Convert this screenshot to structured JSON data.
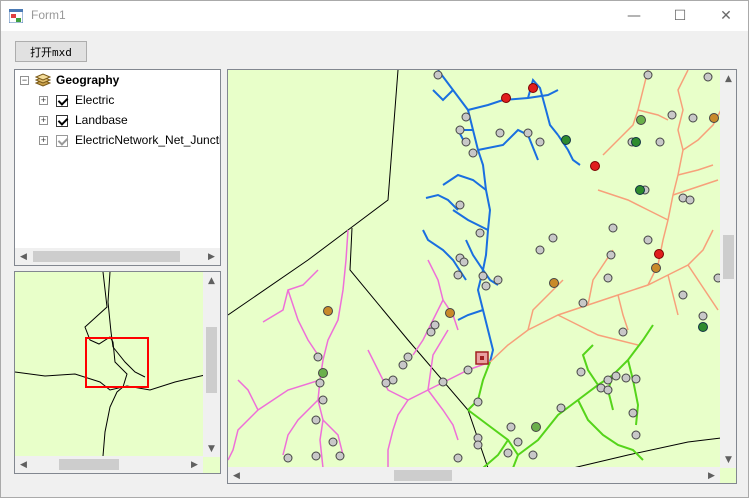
{
  "window": {
    "title": "Form1",
    "minimize": "—",
    "maximize": "☐",
    "close": "✕"
  },
  "toolbar": {
    "open_mxd_label": "打开mxd"
  },
  "toc": {
    "root": {
      "label": "Geography",
      "expander": "⊟"
    },
    "layers": [
      {
        "label": "Electric",
        "checked": true,
        "expander": "+"
      },
      {
        "label": "Landbase",
        "checked": true,
        "expander": "+"
      },
      {
        "label": "ElectricNetwork_Net_Junctions",
        "checked": true,
        "expander": "+"
      }
    ]
  },
  "colors": {
    "map_background": "#e8ffc9",
    "blue_network": "#1a6fe0",
    "pink_network": "#ee6fd8",
    "orange_network": "#f7a07a",
    "green_network": "#55d41a",
    "extent_box": "#ff0000"
  },
  "icons": {
    "app": "form-icon",
    "layers": "layers-icon",
    "scroll_left": "◀",
    "scroll_right": "▶",
    "scroll_up": "▲",
    "scroll_down": "▼"
  }
}
